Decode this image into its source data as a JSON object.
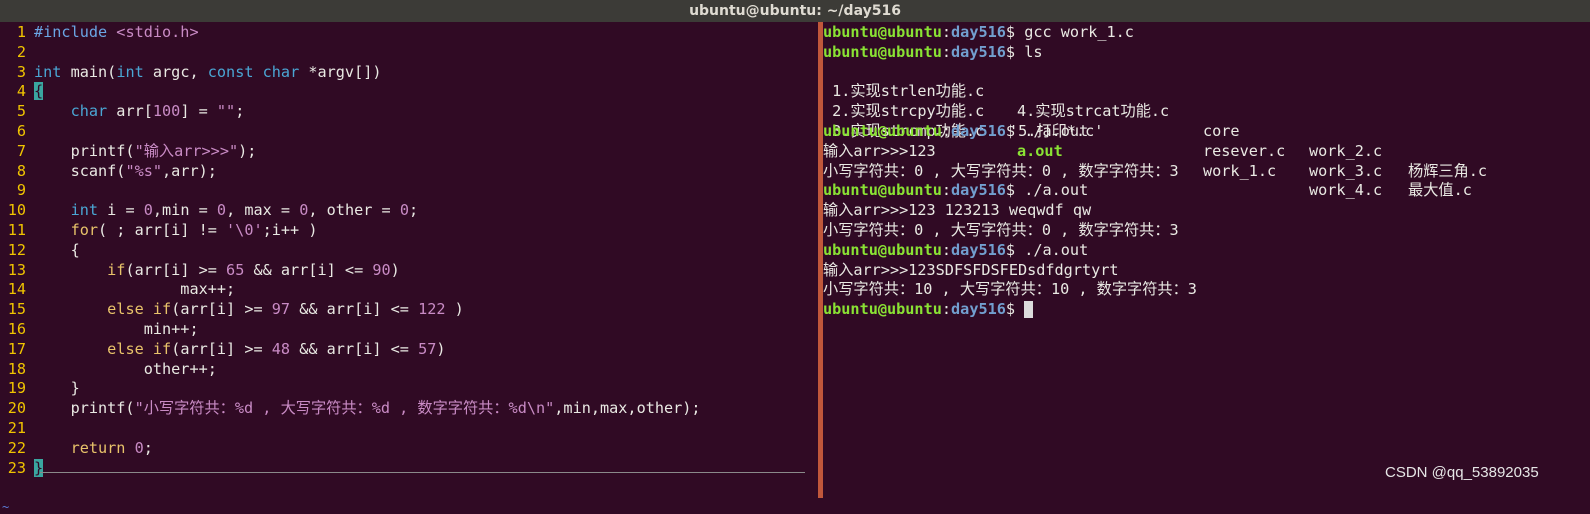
{
  "window": {
    "title": "ubuntu@ubuntu: ~/day516"
  },
  "editor": {
    "line_numbers": [
      "1",
      "2",
      "3",
      "4",
      "5",
      "6",
      "7",
      "8",
      "9",
      "10",
      "11",
      "12",
      "13",
      "14",
      "15",
      "16",
      "17",
      "18",
      "19",
      "20",
      "21",
      "22",
      "23"
    ],
    "tilde": "~"
  },
  "code": {
    "l1": [
      "#include",
      " <stdio.h>"
    ],
    "l3": [
      "int",
      " main(",
      "int",
      " argc, ",
      "const",
      " ",
      "char",
      " *argv[])"
    ],
    "l4": [
      "{"
    ],
    "l5": [
      "    ",
      "char",
      " arr[",
      "100",
      "] = ",
      "\"\"",
      ";"
    ],
    "l7": [
      "    printf(",
      "\"输入arr>>>\"",
      ");"
    ],
    "l8": [
      "    scanf(",
      "\"%s\"",
      ",arr);"
    ],
    "l10": [
      "    ",
      "int",
      " i = ",
      "0",
      ",min = ",
      "0",
      ", max = ",
      "0",
      ", other = ",
      "0",
      ";"
    ],
    "l11": [
      "    ",
      "for",
      "( ; arr[i] != ",
      "'\\0'",
      ";i++ )"
    ],
    "l12": [
      "    {"
    ],
    "l13": [
      "        ",
      "if",
      "(arr[i] >= ",
      "65",
      " && arr[i] <= ",
      "90",
      ")"
    ],
    "l14": [
      "                max++;"
    ],
    "l15": [
      "        ",
      "else",
      " ",
      "if",
      "(arr[i] >= ",
      "97",
      " && arr[i] <= ",
      "122",
      " )"
    ],
    "l16": [
      "            min++;"
    ],
    "l17": [
      "        ",
      "else",
      " ",
      "if",
      "(arr[i] >= ",
      "48",
      " && arr[i] <= ",
      "57",
      ")"
    ],
    "l18": [
      "            other++;"
    ],
    "l19": [
      "    }"
    ],
    "l20": [
      "    printf(",
      "\"小写字符共：%d , 大写字符共：%d , 数字字符共：%d\\n\"",
      ",min,max,other);"
    ],
    "l22": [
      "    ",
      "return",
      " ",
      "0",
      ";"
    ],
    "l23": [
      "}"
    ]
  },
  "terminal": {
    "prompt_user": "ubuntu@ubuntu",
    "prompt_path": "day516",
    "prompt_sep": ":",
    "prompt_end": "$ ",
    "cmd1": "gcc work_1.c",
    "cmd2": "ls",
    "ls": {
      "col1": [
        " 1.实现strlen功能.c",
        " 2.实现strcpy功能.c",
        " 3.实现strcmp功能.c"
      ],
      "col2": [
        "4.实现strcat功能.c",
        "'5.打印*.c'",
        "a.out"
      ],
      "col3": [
        "core",
        "resever.c",
        "work_1.c"
      ],
      "col4": [
        "work_2.c",
        "work_3.c",
        "work_4.c"
      ],
      "col5": [
        "杨辉三角.c",
        "最大值.c"
      ]
    },
    "cmd3": "./a.out",
    "out3a": "输入arr>>>123",
    "out3b": "小写字符共：0 , 大写字符共：0 , 数字字符共：3",
    "cmd4": "./a.out",
    "out4a": "输入arr>>>123 123213 weqwdf qw",
    "out4b": "小写字符共：0 , 大写字符共：0 , 数字字符共：3",
    "cmd5": "./a.out",
    "out5a": "输入arr>>>123SDFSFDSFEDsdfdgrtyrt",
    "out5b": "小写字符共：10 , 大写字符共：10 , 数字字符共：3"
  },
  "watermark": "CSDN @qq_53892035"
}
